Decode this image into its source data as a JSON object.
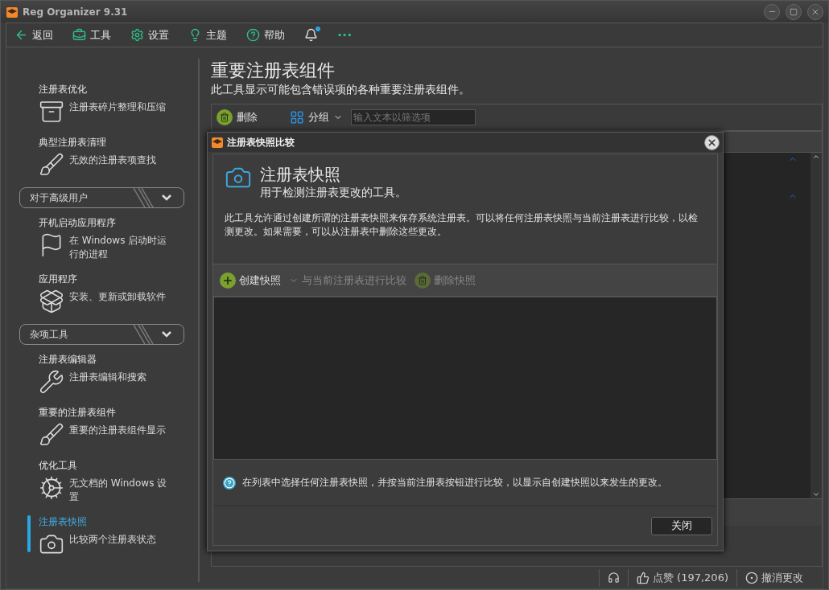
{
  "window": {
    "title": "Reg Organizer 9.31"
  },
  "toolbar": [
    {
      "kind": "back",
      "label": "返回"
    },
    {
      "kind": "tools",
      "label": "工具"
    },
    {
      "kind": "settings",
      "label": "设置"
    },
    {
      "kind": "theme",
      "label": "主题"
    },
    {
      "kind": "help",
      "label": "帮助"
    },
    {
      "kind": "notify",
      "unread": true
    },
    {
      "kind": "more",
      "label": "···"
    }
  ],
  "sidebar": [
    {
      "kind": "item",
      "title": "注册表优化",
      "description": "注册表碎片整理和压缩",
      "selected": false
    },
    {
      "kind": "item",
      "title": "典型注册表清理",
      "description": "无效的注册表项查找",
      "selected": false
    },
    {
      "kind": "group",
      "title": "对于高级用户"
    },
    {
      "kind": "item",
      "title": "开机启动应用程序",
      "description": "在 Windows 启动时运行的进程",
      "selected": false
    },
    {
      "kind": "item",
      "title": "应用程序",
      "description": "安装、更新或卸载软件",
      "selected": false
    },
    {
      "kind": "group",
      "title": "杂项工具"
    },
    {
      "kind": "item",
      "title": "注册表编辑器",
      "description": "注册表编辑和搜索",
      "selected": false
    },
    {
      "kind": "item",
      "title": "重要的注册表组件",
      "description": "重要的注册表组件显示",
      "selected": false
    },
    {
      "kind": "item",
      "title": "优化工具",
      "description": "无文档的 Windows 设置",
      "selected": false
    },
    {
      "kind": "item",
      "title": "注册表快照",
      "description": "比较两个注册表状态",
      "selected": true
    }
  ],
  "page": {
    "title": "重要注册表组件",
    "subtitle": "此工具显示可能包含错误项的各种重要注册表组件。",
    "delete": "删除",
    "group": "分组",
    "filter": {
      "placeholder": "输入文本以筛选项"
    }
  },
  "dialog": {
    "title": "注册表快照比较",
    "heading": "注册表快照",
    "subheading": "用于检测注册表更改的工具。",
    "description": "此工具允许通过创建所谓的注册表快照来保存系统注册表。可以将任何注册表快照与当前注册表进行比较，以检测更改。如果需要，可以从注册表中删除这些更改。",
    "actions": [
      {
        "kind": "create",
        "label": "创建快照",
        "disabled": false
      },
      {
        "kind": "compare",
        "label": "与当前注册表进行比较",
        "disabled": true
      },
      {
        "kind": "delete",
        "label": "删除快照",
        "disabled": true
      }
    ],
    "hint": "在列表中选择任何注册表快照，并按当前注册表按钮进行比较，以显示自创建快照以来发生的更改。",
    "close": "关闭"
  },
  "status_bar": {
    "likes": "点赞 (197,206)",
    "undo": "撤消更改"
  }
}
